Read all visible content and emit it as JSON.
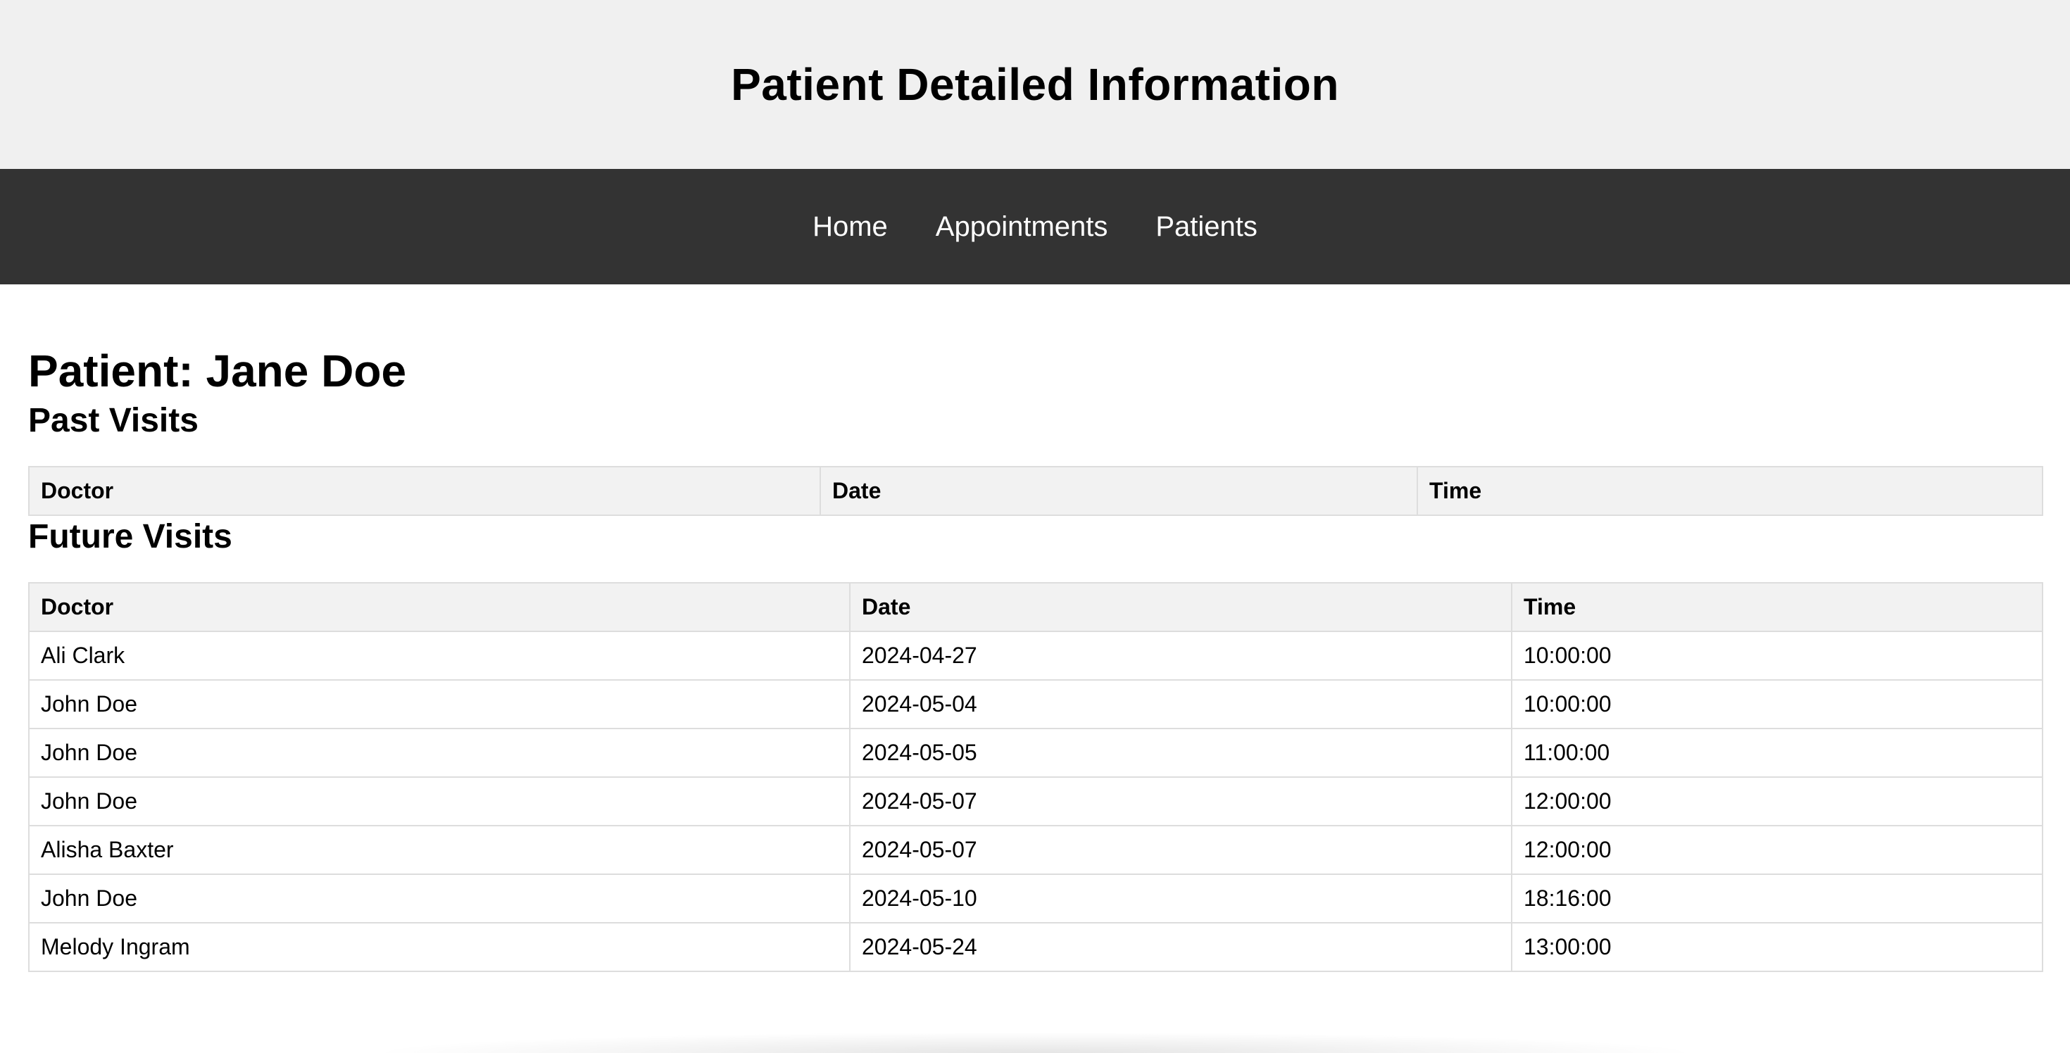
{
  "header": {
    "title": "Patient Detailed Information"
  },
  "nav": {
    "items": [
      {
        "label": "Home"
      },
      {
        "label": "Appointments"
      },
      {
        "label": "Patients"
      }
    ]
  },
  "patient": {
    "heading": "Patient: Jane Doe"
  },
  "past_visits": {
    "title": "Past Visits",
    "columns": [
      "Doctor",
      "Date",
      "Time"
    ],
    "rows": []
  },
  "future_visits": {
    "title": "Future Visits",
    "columns": [
      "Doctor",
      "Date",
      "Time"
    ],
    "rows": [
      {
        "doctor": "Ali Clark",
        "date": "2024-04-27",
        "time": "10:00:00"
      },
      {
        "doctor": "John Doe",
        "date": "2024-05-04",
        "time": "10:00:00"
      },
      {
        "doctor": "John Doe",
        "date": "2024-05-05",
        "time": "11:00:00"
      },
      {
        "doctor": "John Doe",
        "date": "2024-05-07",
        "time": "12:00:00"
      },
      {
        "doctor": "Alisha Baxter",
        "date": "2024-05-07",
        "time": "12:00:00"
      },
      {
        "doctor": "John Doe",
        "date": "2024-05-10",
        "time": "18:16:00"
      },
      {
        "doctor": "Melody Ingram",
        "date": "2024-05-24",
        "time": "13:00:00"
      }
    ]
  }
}
